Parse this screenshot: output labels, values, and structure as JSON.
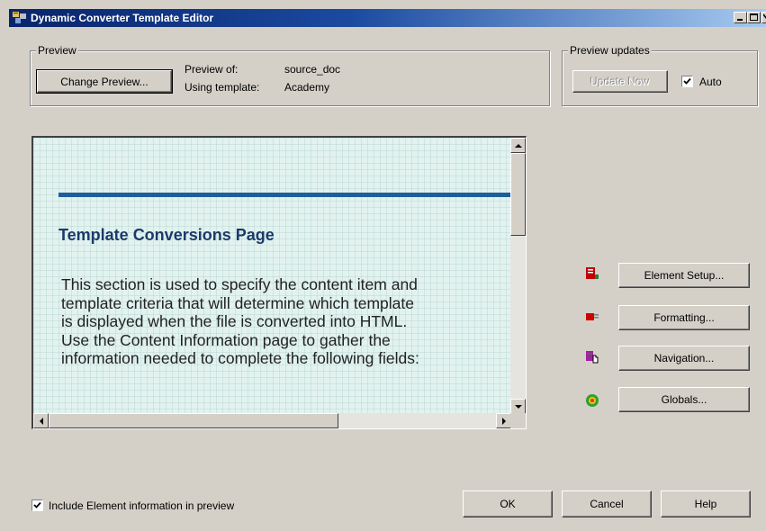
{
  "window": {
    "title": "Dynamic Converter Template Editor",
    "controls": [
      "minimize-icon",
      "maximize-icon",
      "close-icon"
    ]
  },
  "preview_group": {
    "legend": "Preview",
    "change_button": "Change Preview...",
    "preview_of_label": "Preview of:",
    "preview_of_value": "source_doc",
    "using_template_label": "Using template:",
    "using_template_value": "Academy"
  },
  "updates_group": {
    "legend": "Preview updates",
    "update_now_button": "Update Now",
    "auto_label": "Auto",
    "auto_checked": true
  },
  "preview_content": {
    "heading": "Template Conversions Page",
    "body_lines": [
      "This section is used to specify the content item and",
      "template criteria that will determine which template",
      "is displayed when the file is converted into HTML.",
      "Use the Content Information page to gather the",
      "information needed to complete the following fields:"
    ],
    "colors": {
      "rule": "#1f5f99",
      "heading": "#1b3a6b",
      "background": "#e2f2ef"
    }
  },
  "side_buttons": [
    {
      "label": "Element Setup...",
      "icon": "element-setup-icon"
    },
    {
      "label": "Formatting...",
      "icon": "formatting-icon"
    },
    {
      "label": "Navigation...",
      "icon": "navigation-icon"
    },
    {
      "label": "Globals...",
      "icon": "globals-icon"
    }
  ],
  "footer": {
    "include_label": "Include Element information in preview",
    "include_checked": true,
    "ok": "OK",
    "cancel": "Cancel",
    "help": "Help"
  }
}
